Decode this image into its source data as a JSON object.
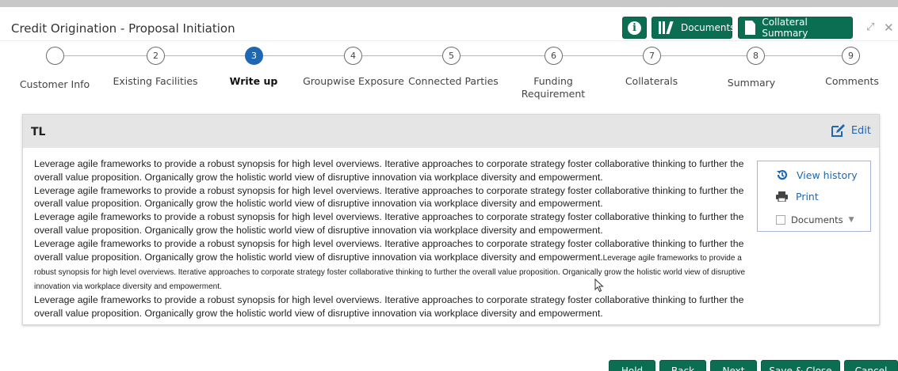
{
  "header": {
    "title": "Credit Origination - Proposal Initiation",
    "documents_label": "Documents",
    "collateral_label": "Collateral Summary",
    "brand_color": "#0b6e52"
  },
  "steps": [
    {
      "number": "",
      "label": "Customer Info",
      "state": "completed"
    },
    {
      "number": "2",
      "label": "Existing Facilities",
      "state": "pending"
    },
    {
      "number": "3",
      "label": "Write up",
      "state": "current"
    },
    {
      "number": "4",
      "label": "Groupwise Exposure",
      "state": "pending"
    },
    {
      "number": "5",
      "label": "Connected Parties",
      "state": "pending"
    },
    {
      "number": "6",
      "label": "Funding Requirement",
      "label_line1": "Funding",
      "label_line2": "Requirement",
      "state": "pending"
    },
    {
      "number": "7",
      "label": "Collaterals",
      "state": "pending"
    },
    {
      "number": "8",
      "label": "Summary",
      "state": "pending"
    },
    {
      "number": "9",
      "label": "Comments",
      "state": "pending"
    }
  ],
  "panel": {
    "title": "TL",
    "edit_label": "Edit",
    "paragraph_text": "Leverage agile frameworks to provide a robust synopsis for high level overviews. Iterative approaches to corporate strategy foster collaborative thinking to further the overall value proposition. Organically grow the holistic world view of disruptive innovation via workplace diversity and empowerment.",
    "small_text": "Leverage agile frameworks to provide a robust synopsis for high level overviews. Iterative approaches to corporate strategy foster collaborative thinking to further the overall value proposition. Organically grow the holistic world view of disruptive innovation via workplace diversity and empowerment."
  },
  "side_actions": {
    "view_history": "View history",
    "print": "Print",
    "documents": "Documents"
  },
  "footer": {
    "hold": "Hold",
    "back": "Back",
    "next": "Next",
    "save_close": "Save & Close",
    "cancel": "Cancel"
  },
  "colors": {
    "accent_blue": "#1e68b3",
    "button_green": "#0b6e52",
    "panel_header": "#e5e5e5"
  }
}
